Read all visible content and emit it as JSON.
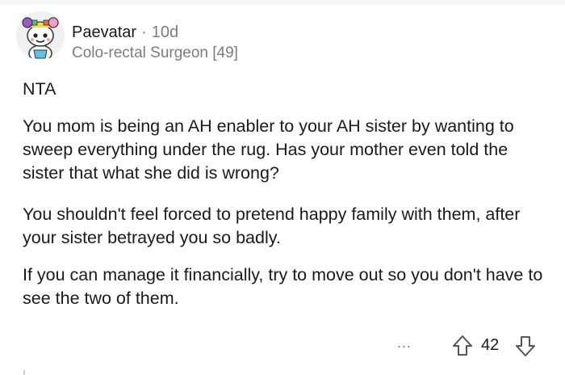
{
  "comment": {
    "author": "Paevatar",
    "separator": "·",
    "age": "10d",
    "flair": "Colo-rectal Surgeon [49]",
    "paragraphs": [
      "NTA",
      "You mom is being an AH  enabler to your AH sister by wanting to sweep everything under the rug. Has your mother even told the sister that what she did is wrong?",
      "You shouldn't feel forced to pretend happy family with them, after your sister betrayed you so badly.",
      "If you can manage it financially, try to move out so you don't have to see the two of them."
    ],
    "actions": {
      "more_label": "...",
      "score": "42"
    }
  },
  "icons": {
    "avatar": "avatar-icon",
    "more": "more-options-icon",
    "upvote": "upvote-arrow-icon",
    "downvote": "downvote-arrow-icon"
  },
  "colors": {
    "text": "#1a1a1b",
    "muted": "#7c7c7c",
    "divider": "#f6f7f8"
  }
}
